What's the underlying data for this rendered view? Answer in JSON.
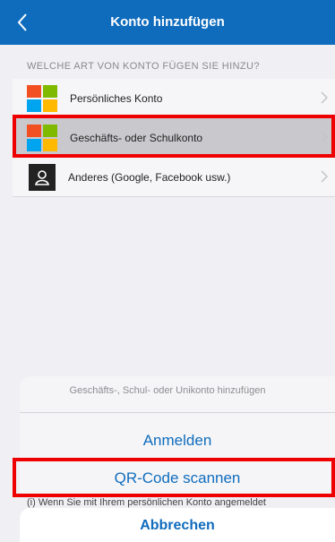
{
  "header": {
    "title": "Konto hinzufügen",
    "back_icon": "chevron-left-icon"
  },
  "section": {
    "label": "WELCHE ART VON KONTO FÜGEN SIE HINZU?"
  },
  "accounts": [
    {
      "label": "Persönliches Konto",
      "icon": "microsoft-logo-icon"
    },
    {
      "label": "Geschäfts- oder Schulkonto",
      "icon": "microsoft-logo-icon",
      "selected": true
    },
    {
      "label": "Anderes (Google, Facebook usw.)",
      "icon": "person-icon"
    }
  ],
  "sheet": {
    "title": "Geschäfts-, Schul- oder Unikonto hinzufügen",
    "signin_label": "Anmelden",
    "qr_label": "QR-Code scannen",
    "info_text": "(i)  Wenn Sie mit Ihrem persönlichen Konto angemeldet",
    "cancel_label": "Abbrechen"
  },
  "colors": {
    "header_bg": "#0f6cbd",
    "accent": "#0f6cbd",
    "annotation": "#ee0000"
  }
}
